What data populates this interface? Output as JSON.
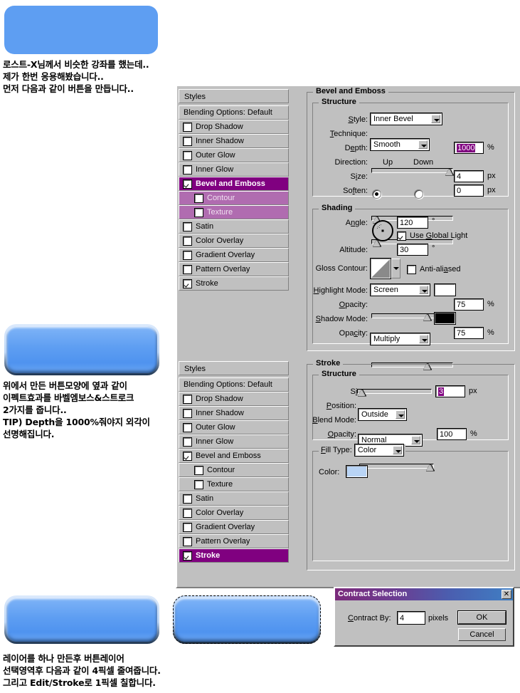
{
  "tutorial": {
    "intro_lines": [
      "로스트-X님께서 비슷한 강좌를 했는데..",
      "제가 한번 응용해봤습니다..",
      "먼저 다음과 같이 버튼을 만듭니다.."
    ],
    "middle_lines": [
      "위에서 만든 버튼모양에 옆과 같이",
      "이펙트효과를 바벨엠보스&스트로크",
      "2가지를 줍니다..",
      "TIP) Depth을 1000%줘야지 외각이",
      "선명해집니다."
    ],
    "bottom_lines": [
      "레이어를 하나 만든후 버튼레이어",
      "선택영역후 다음과 같이 4픽셀 줄여줍니다.",
      "그리고 Edit/Stroke로 1픽셀 칠합니다."
    ]
  },
  "colors": {
    "button_blue": "#5e9ef2",
    "dialog_gray": "#c0c0c0",
    "selection_purple": "#800080",
    "stroke_color": "#b9d4f5"
  },
  "styles_panel": {
    "header": "Styles",
    "blending_options": "Blending Options: Default",
    "list_top": [
      {
        "label": "Drop Shadow",
        "checked": false,
        "indent": false,
        "state": "normal"
      },
      {
        "label": "Inner Shadow",
        "checked": false,
        "indent": false,
        "state": "normal"
      },
      {
        "label": "Outer Glow",
        "checked": false,
        "indent": false,
        "state": "normal"
      },
      {
        "label": "Inner Glow",
        "checked": false,
        "indent": false,
        "state": "normal"
      },
      {
        "label": "Bevel and Emboss",
        "checked": true,
        "indent": false,
        "state": "selected"
      },
      {
        "label": "Contour",
        "checked": false,
        "indent": true,
        "state": "sub-selected"
      },
      {
        "label": "Texture",
        "checked": false,
        "indent": true,
        "state": "sub-selected"
      },
      {
        "label": "Satin",
        "checked": false,
        "indent": false,
        "state": "normal"
      },
      {
        "label": "Color Overlay",
        "checked": false,
        "indent": false,
        "state": "normal"
      },
      {
        "label": "Gradient Overlay",
        "checked": false,
        "indent": false,
        "state": "normal"
      },
      {
        "label": "Pattern Overlay",
        "checked": false,
        "indent": false,
        "state": "normal"
      },
      {
        "label": "Stroke",
        "checked": true,
        "indent": false,
        "state": "normal"
      }
    ],
    "list_bottom": [
      {
        "label": "Drop Shadow",
        "checked": false,
        "indent": false,
        "state": "normal"
      },
      {
        "label": "Inner Shadow",
        "checked": false,
        "indent": false,
        "state": "normal"
      },
      {
        "label": "Outer Glow",
        "checked": false,
        "indent": false,
        "state": "normal"
      },
      {
        "label": "Inner Glow",
        "checked": false,
        "indent": false,
        "state": "normal"
      },
      {
        "label": "Bevel and Emboss",
        "checked": true,
        "indent": false,
        "state": "normal"
      },
      {
        "label": "Contour",
        "checked": false,
        "indent": true,
        "state": "normal"
      },
      {
        "label": "Texture",
        "checked": false,
        "indent": true,
        "state": "normal"
      },
      {
        "label": "Satin",
        "checked": false,
        "indent": false,
        "state": "normal"
      },
      {
        "label": "Color Overlay",
        "checked": false,
        "indent": false,
        "state": "normal"
      },
      {
        "label": "Gradient Overlay",
        "checked": false,
        "indent": false,
        "state": "normal"
      },
      {
        "label": "Pattern Overlay",
        "checked": false,
        "indent": false,
        "state": "normal"
      },
      {
        "label": "Stroke",
        "checked": true,
        "indent": false,
        "state": "selected"
      }
    ]
  },
  "bevel_panel": {
    "title": "Bevel and Emboss",
    "structure": {
      "title": "Structure",
      "style_label": "Style:",
      "style_value": "Inner Bevel",
      "technique_label": "Technique:",
      "technique_value": "Smooth",
      "depth_label": "Depth:",
      "depth_value": "1000",
      "depth_unit": "%",
      "direction_label": "Direction:",
      "direction_up": "Up",
      "direction_down": "Down",
      "size_label": "Size:",
      "size_value": "4",
      "size_unit": "px",
      "soften_label": "Soften:",
      "soften_value": "0",
      "soften_unit": "px"
    },
    "shading": {
      "title": "Shading",
      "angle_label": "Angle:",
      "angle_value": "120",
      "angle_unit": "°",
      "global_light_label": "Use Global Light",
      "global_light_checked": true,
      "altitude_label": "Altitude:",
      "altitude_value": "30",
      "altitude_unit": "°",
      "gloss_contour_label": "Gloss Contour:",
      "anti_aliased_label": "Anti-aliased",
      "anti_aliased_checked": false,
      "highlight_mode_label": "Highlight Mode:",
      "highlight_mode_value": "Screen",
      "highlight_color": "#ffffff",
      "highlight_opacity_label": "Opacity:",
      "highlight_opacity_value": "75",
      "highlight_opacity_unit": "%",
      "shadow_mode_label": "Shadow Mode:",
      "shadow_mode_value": "Multiply",
      "shadow_color": "#000000",
      "shadow_opacity_label": "Opacity:",
      "shadow_opacity_value": "75",
      "shadow_opacity_unit": "%"
    }
  },
  "stroke_panel": {
    "title": "Stroke",
    "structure": {
      "title": "Structure",
      "size_label": "Size:",
      "size_value": "3",
      "size_unit": "px",
      "position_label": "Position:",
      "position_value": "Outside",
      "blend_mode_label": "Blend Mode:",
      "blend_mode_value": "Normal",
      "opacity_label": "Opacity:",
      "opacity_value": "100",
      "opacity_unit": "%"
    },
    "fill": {
      "fill_type_label": "Fill Type:",
      "fill_type_value": "Color",
      "color_label": "Color:",
      "color_value": "#b9d4f5"
    }
  },
  "contract_dialog": {
    "title": "Contract Selection",
    "close_label": "✕",
    "contract_by_label": "Contract By:",
    "contract_by_value": "4",
    "pixels_label": "pixels",
    "ok_label": "OK",
    "cancel_label": "Cancel"
  }
}
